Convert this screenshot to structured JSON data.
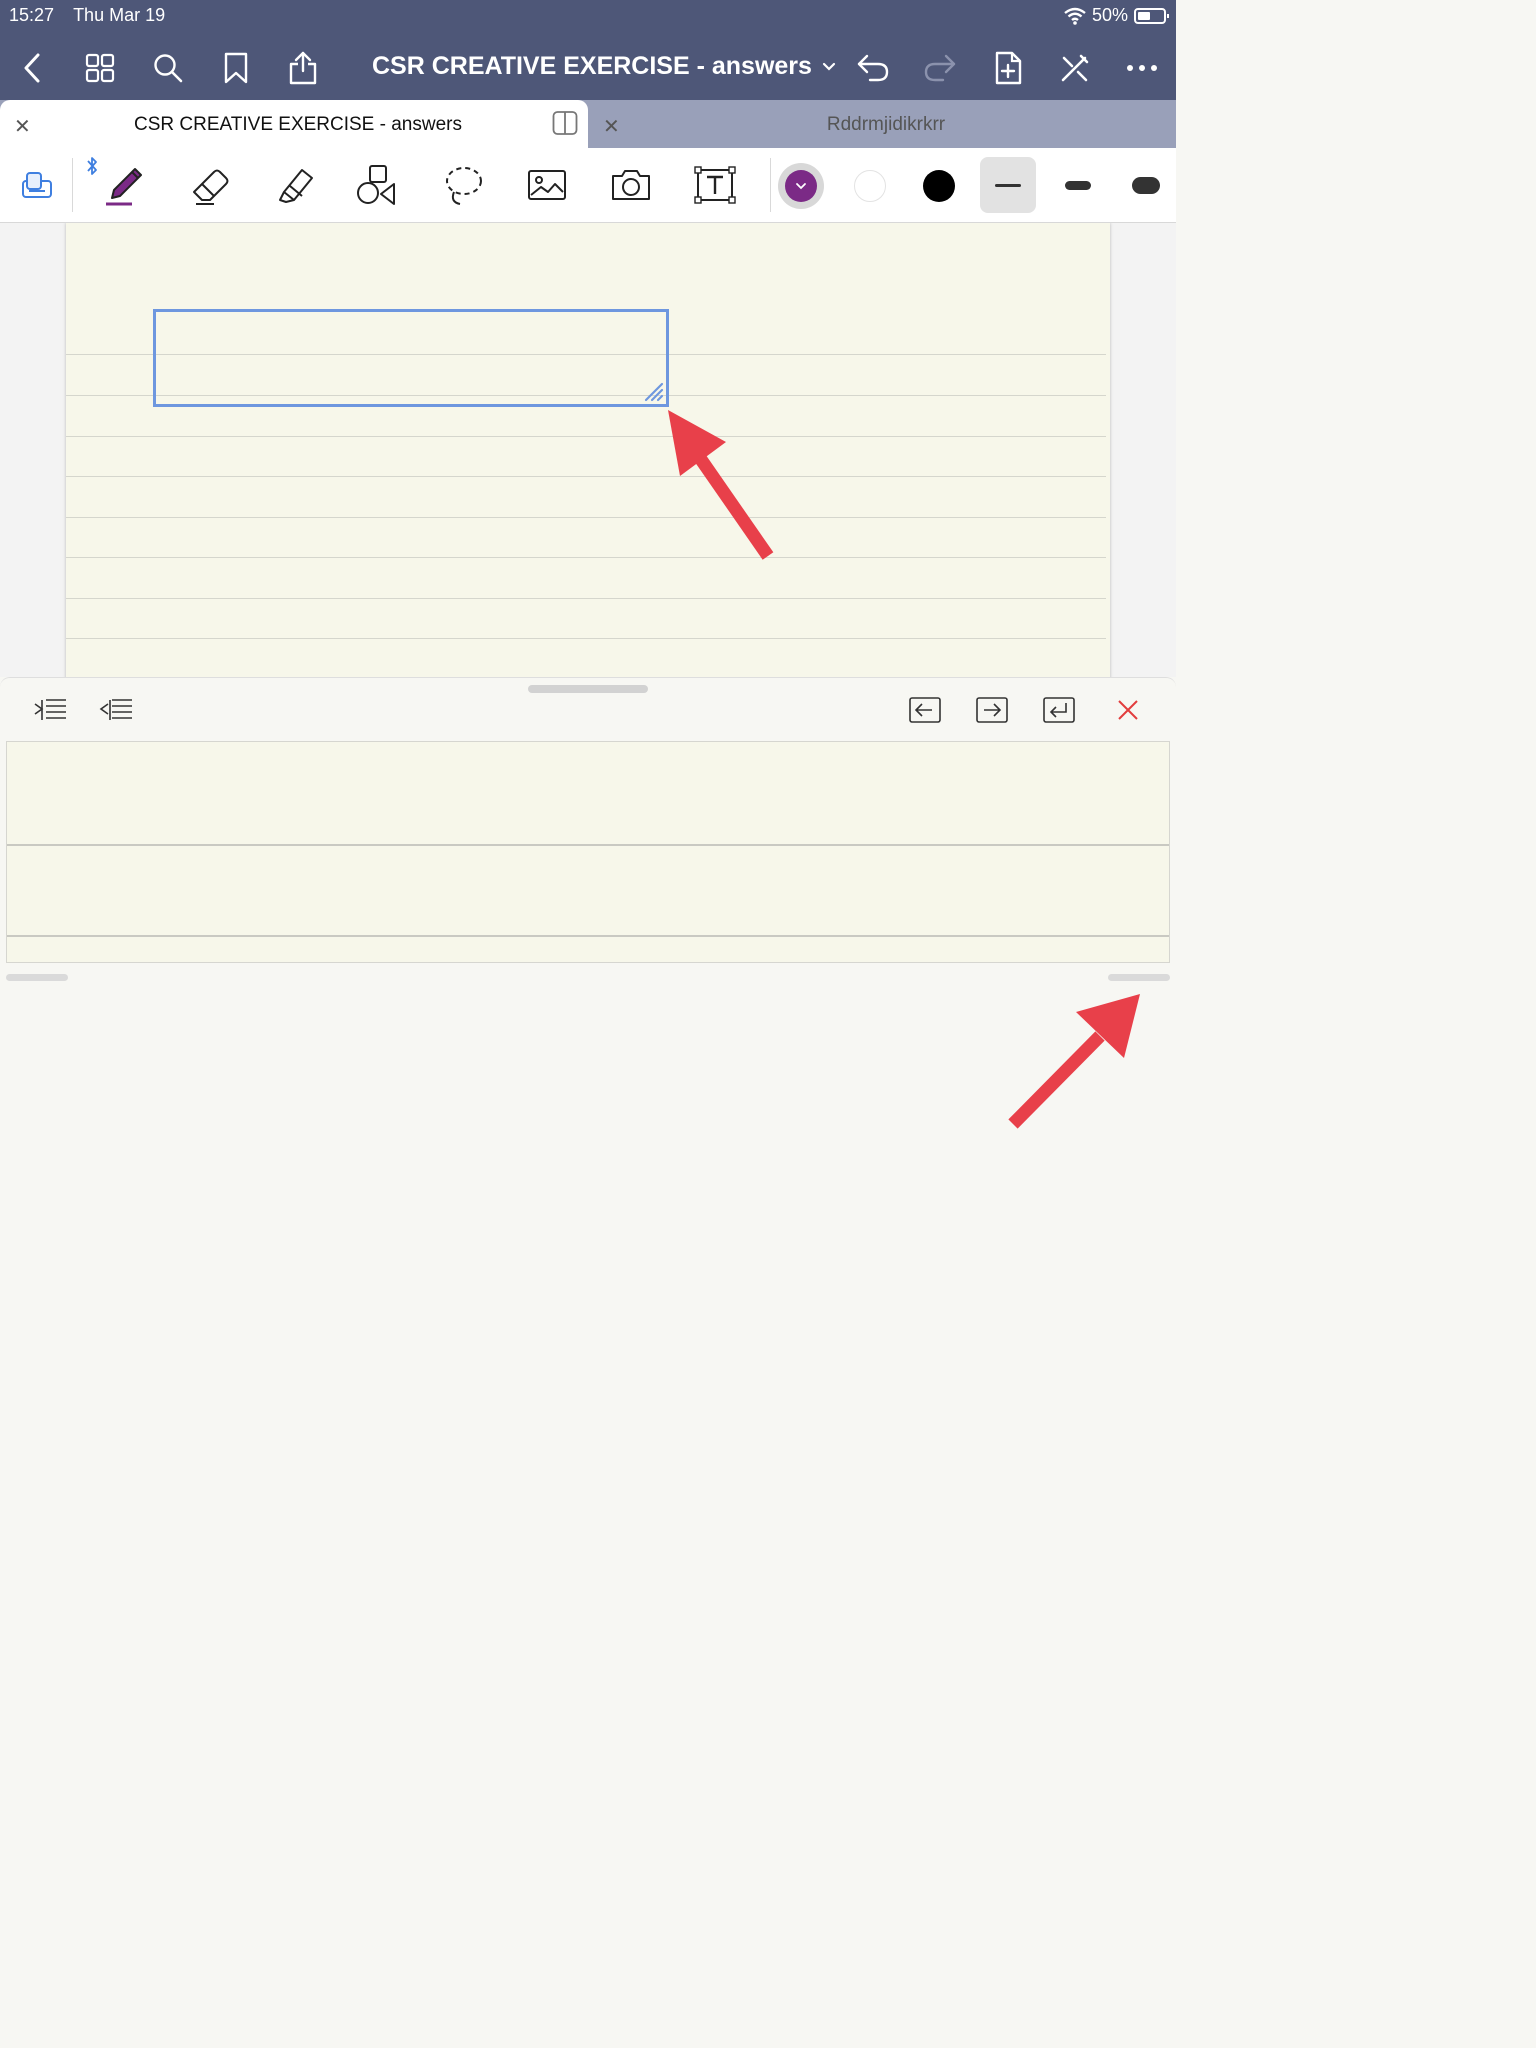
{
  "status_bar": {
    "time": "15:27",
    "date": "Thu Mar 19",
    "battery": "50%"
  },
  "nav_bar": {
    "document_title": "CSR CREATIVE EXERCISE - answers"
  },
  "tabs": [
    {
      "label": "CSR CREATIVE EXERCISE - answers",
      "active": true
    },
    {
      "label": "Rddrmjidikrkrr",
      "active": false
    }
  ],
  "tools": {
    "items": [
      "selection",
      "pen",
      "eraser",
      "highlighter",
      "shapes",
      "lasso",
      "image",
      "camera",
      "text"
    ],
    "selected": "pen",
    "colors": [
      "#7b2a86",
      "#ffffff",
      "#000000"
    ],
    "selected_color": "#7b2a86",
    "stroke_widths": [
      "thin",
      "medium",
      "thick"
    ],
    "selected_width": "thin"
  },
  "text_panel": {
    "tools": [
      "indent",
      "outdent",
      "move-left",
      "move-right",
      "new-line",
      "close"
    ]
  },
  "colors": {
    "nav_bg": "#4e5778",
    "tab_inactive_bg": "#99a0b9",
    "accent_blue": "#6e97df",
    "annotation_red": "#e8404a",
    "paper": "#f7f7ea"
  }
}
